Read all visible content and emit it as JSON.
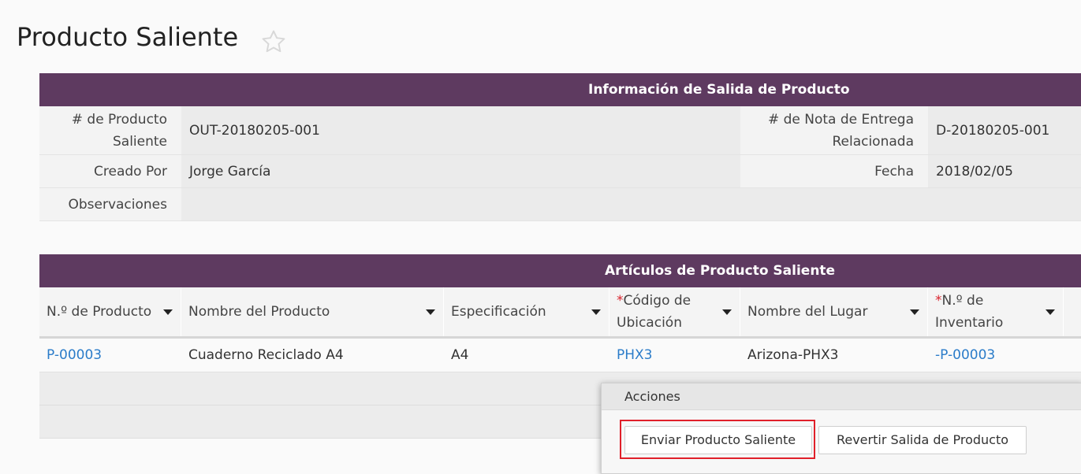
{
  "page": {
    "title": "Producto Saliente"
  },
  "info": {
    "header": "Información de Salida de Producto",
    "outbound_no_label": "# de Producto Saliente",
    "outbound_no": "OUT-20180205-001",
    "delivery_note_label": "# de Nota de Entrega Relacionada",
    "delivery_note": "D-20180205-001",
    "created_by_label": "Creado Por",
    "created_by": "Jorge García",
    "date_label": "Fecha",
    "date": "2018/02/05",
    "notes_label": "Observaciones",
    "notes": ""
  },
  "items": {
    "header": "Artículos de Producto Saliente",
    "columns": [
      {
        "label": "N.º de Producto",
        "required": false
      },
      {
        "label": "Nombre del Producto",
        "required": false
      },
      {
        "label": "Especificación",
        "required": false
      },
      {
        "label": "Código de Ubicación",
        "required": true
      },
      {
        "label": "Nombre del Lugar",
        "required": false
      },
      {
        "label": "N.º de Inventario",
        "required": true
      }
    ],
    "rows": [
      {
        "product_no": "P-00003",
        "product_name": "Cuaderno Reciclado A4",
        "spec": "A4",
        "location_code": "PHX3",
        "place_name": "Arizona-PHX3",
        "inventory_no": "-P-00003"
      }
    ]
  },
  "actions": {
    "title": "Acciones",
    "submit_label": "Enviar Producto Saliente",
    "revert_label": "Revertir Salida de Producto"
  },
  "colors": {
    "header_bg": "#5e3a60",
    "link": "#2b7cc9",
    "required": "#d9232d",
    "highlight": "#e0202a"
  },
  "icons": {
    "favorite": "star-outline-icon",
    "sort": "caret-down-icon"
  }
}
